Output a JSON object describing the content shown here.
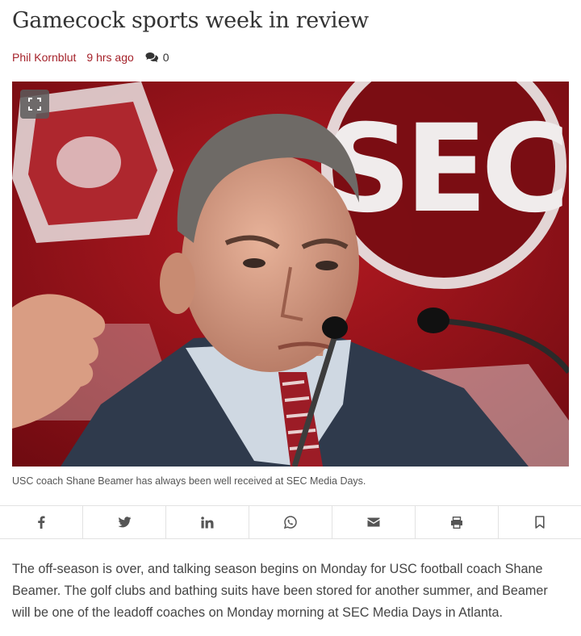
{
  "article": {
    "headline": "Gamecock sports week in review",
    "author": "Phil Kornblut",
    "time_ago": "9 hrs ago",
    "comment_count": "0"
  },
  "photo": {
    "caption": "USC coach Shane Beamer has always been well received at SEC Media Days.",
    "background_logo_text": "SEC",
    "expand_icon": "expand-icon"
  },
  "share": {
    "items": [
      {
        "icon": "facebook-icon"
      },
      {
        "icon": "twitter-icon"
      },
      {
        "icon": "linkedin-icon"
      },
      {
        "icon": "whatsapp-icon"
      },
      {
        "icon": "email-icon"
      },
      {
        "icon": "print-icon"
      },
      {
        "icon": "bookmark-icon"
      }
    ]
  },
  "body": {
    "paragraph_1": "The off-season is over, and talking season begins on Monday for USC football coach Shane Beamer. The golf clubs and bathing suits have been stored for another summer, and Beamer will be one of the leadoff coaches on Monday morning at SEC Media Days in Atlanta."
  },
  "colors": {
    "accent": "#a5222a",
    "text": "#333333",
    "divider": "#e2e2e2"
  }
}
